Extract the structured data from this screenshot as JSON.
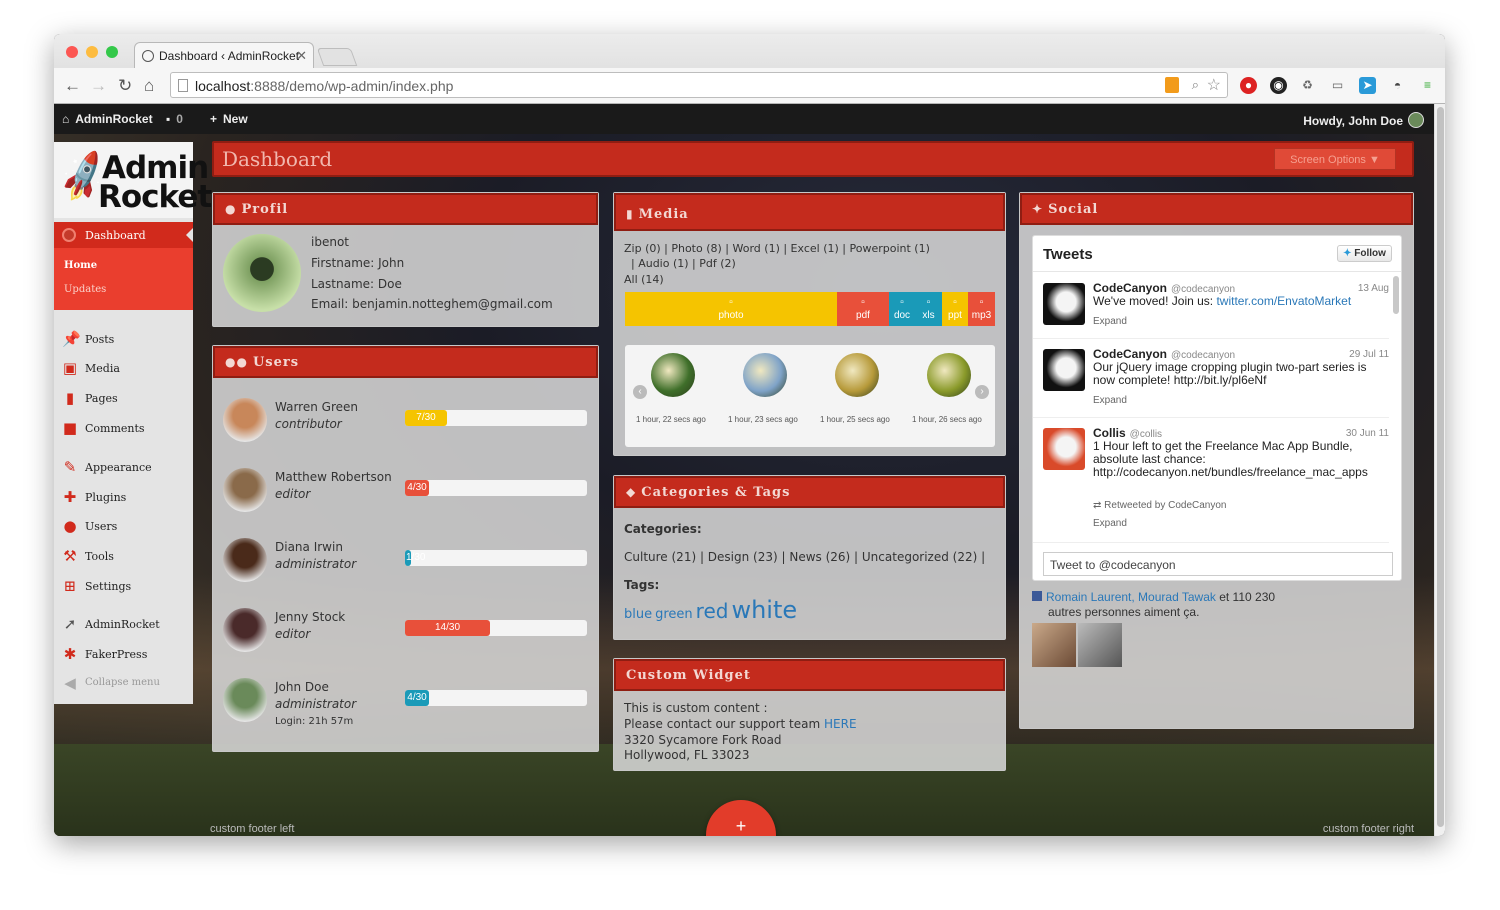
{
  "browser": {
    "tab_title": "Dashboard ‹ AdminRocket",
    "url_host": "localhost",
    "url_path": ":8888/demo/wp-admin/index.php"
  },
  "adminbar": {
    "site": "AdminRocket",
    "comments_count": "0",
    "new_label": "New",
    "howdy": "Howdy, John Doe"
  },
  "logo": {
    "line1": "Admin",
    "line2": "Rocket"
  },
  "sidebar": {
    "current": "Dashboard",
    "sub": [
      "Home",
      "Updates"
    ],
    "items": [
      "Posts",
      "Media",
      "Pages",
      "Comments",
      "Appearance",
      "Plugins",
      "Users",
      "Tools",
      "Settings",
      "AdminRocket",
      "FakerPress",
      "Collapse menu"
    ]
  },
  "dashboard": {
    "title": "Dashboard",
    "screen_options": "Screen Options ▼"
  },
  "profil": {
    "title": "Profil",
    "username": "ibenot",
    "firstname": "Firstname: John",
    "lastname": "Lastname: Doe",
    "email": "Email: benjamin.notteghem@gmail.com"
  },
  "users": {
    "title": "Users",
    "list": [
      {
        "name": "Warren Green",
        "role": "contributor",
        "progress_label": "7/30",
        "progress": 0.233,
        "color": "#f5c400"
      },
      {
        "name": "Matthew Robertson",
        "role": "editor",
        "progress_label": "4/30",
        "progress": 0.133,
        "color": "#e8503a"
      },
      {
        "name": "Diana Irwin",
        "role": "administrator",
        "progress_label": "1/30",
        "progress": 0.033,
        "color": "#1a9ab8"
      },
      {
        "name": "Jenny Stock",
        "role": "editor",
        "progress_label": "14/30",
        "progress": 0.467,
        "color": "#e8503a"
      },
      {
        "name": "John Doe",
        "role": "administrator",
        "progress_label": "4/30",
        "progress": 0.133,
        "color": "#1a9ab8",
        "extra": "Login: 21h 57m"
      }
    ]
  },
  "media": {
    "title": "Media",
    "filters_line1": "Zip (0)  |  Photo (8)  |  Word (1)  |  Excel (1)  |  Powerpoint (1)",
    "filters_line2": "|  Audio (1)  |  Pdf (2)",
    "filters_line3": "All (14)",
    "stack": [
      {
        "label": "photo",
        "color": "#f5c400",
        "share": 8
      },
      {
        "label": "pdf",
        "color": "#e8503a",
        "share": 2
      },
      {
        "label": "doc",
        "color": "#1a9ab8",
        "share": 1
      },
      {
        "label": "xls",
        "color": "#1a9ab8",
        "share": 1
      },
      {
        "label": "ppt",
        "color": "#f5c400",
        "share": 1
      },
      {
        "label": "mp3",
        "color": "#e8503a",
        "share": 1
      }
    ],
    "thumbs": [
      {
        "caption": "1 hour, 22 secs ago",
        "color": "#3f6f2a"
      },
      {
        "caption": "1 hour, 23 secs ago",
        "color": "#7fa3c8"
      },
      {
        "caption": "1 hour, 25 secs ago",
        "color": "#b79a3a"
      },
      {
        "caption": "1 hour, 26 secs ago",
        "color": "#8a9a2a"
      }
    ]
  },
  "categories": {
    "title": "Categories & Tags",
    "cat_label": "Categories:",
    "cat_list": "Culture (21)  |  Design (23)  |  News (26)  |  Uncategorized (22)  |",
    "tags_label": "Tags:",
    "tags": [
      {
        "text": "blue",
        "size": "small"
      },
      {
        "text": "green",
        "size": "small"
      },
      {
        "text": "red",
        "size": "medium"
      },
      {
        "text": "white",
        "size": "large"
      }
    ]
  },
  "custom_widget": {
    "title": "Custom Widget",
    "line1": "This is custom content :",
    "line2_prefix": "Please contact our support team ",
    "line2_link": "HERE",
    "line3": "3320 Sycamore Fork Road",
    "line4": "Hollywood, FL 33023"
  },
  "social": {
    "title": "Social",
    "tweets_title": "Tweets",
    "follow": "Follow",
    "tweets": [
      {
        "name": "CodeCanyon",
        "handle": "@codecanyon",
        "date": "13 Aug",
        "body": "We've moved! Join us: ",
        "link": "twitter.com/EnvatoMarket",
        "expand": "Expand"
      },
      {
        "name": "CodeCanyon",
        "handle": "@codecanyon",
        "date": "29 Jul 11",
        "body": "Our jQuery image cropping plugin two-part series is now complete! http://bit.ly/pl6eNf",
        "expand": "Expand"
      },
      {
        "name": "Collis",
        "handle": "@collis",
        "date": "30 Jun 11",
        "body": "1 Hour left to get the Freelance Mac App Bundle, absolute last chance: http://codecanyon.net/bundles/freelance_mac_apps",
        "retweet": "Retweeted by CodeCanyon",
        "expand": "Expand"
      }
    ],
    "tweet_input_placeholder": "Tweet to @codecanyon",
    "fb_names": "Romain Laurent, Mourad Tawak",
    "fb_rest": " et 110 230",
    "fb_line2": "autres personnes aiment ça."
  },
  "footer": {
    "left": "custom footer left",
    "right": "custom footer right",
    "fab": "+"
  }
}
